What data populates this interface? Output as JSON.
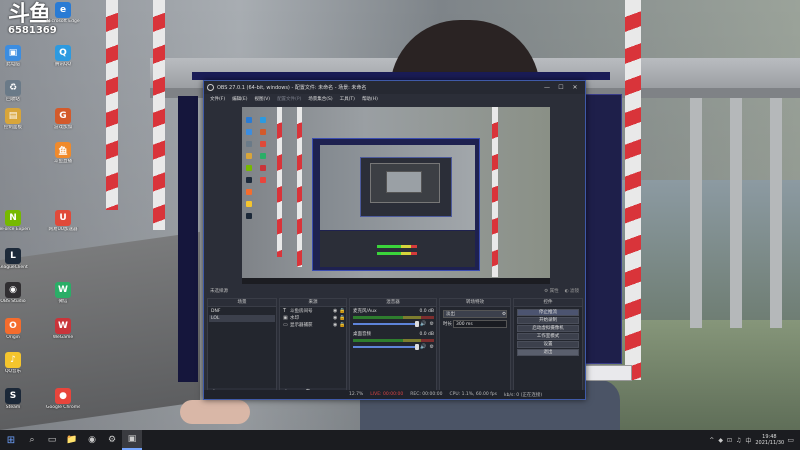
{
  "desktop": {
    "logo": {
      "glyph": "斗鱼",
      "room_number": "6581369"
    },
    "icons": [
      {
        "label": "Microsoft Edge",
        "color": "#2a7bd4",
        "glyph": "e"
      },
      {
        "label": "此电脑",
        "color": "#3c8de0",
        "glyph": "▣"
      },
      {
        "label": "腾讯QQ",
        "color": "#2d9ae0",
        "glyph": "Q"
      },
      {
        "label": "回收站",
        "color": "#6a7a88",
        "glyph": "♻"
      },
      {
        "label": "控制面板",
        "color": "#d8a53a",
        "glyph": "▤"
      },
      {
        "label": "游戏加加",
        "color": "#d35a2b",
        "glyph": "G"
      },
      {
        "label": "GeForce Experience",
        "color": "#76b900",
        "glyph": "N"
      },
      {
        "label": "网易UU加速器",
        "color": "#e04a3a",
        "glyph": "U"
      },
      {
        "label": "LeagueClient",
        "color": "#1d2a3a",
        "glyph": "L"
      },
      {
        "label": "OBS Studio",
        "color": "#302e31",
        "glyph": "◉"
      },
      {
        "label": "微信",
        "color": "#2aae67",
        "glyph": "W"
      },
      {
        "label": "Origin",
        "color": "#f56c2d",
        "glyph": "O"
      },
      {
        "label": "WeGame",
        "color": "#c9343a",
        "glyph": "W"
      },
      {
        "label": "QQ音乐",
        "color": "#f5c52d",
        "glyph": "♪"
      },
      {
        "label": "Steam",
        "color": "#1b2838",
        "glyph": "S"
      },
      {
        "label": "Google Chrome",
        "color": "#e8453c",
        "glyph": "●"
      },
      {
        "label": "斗鱼直播",
        "color": "#f08a2b",
        "glyph": "鱼"
      }
    ]
  },
  "obs": {
    "title": "OBS 27.0.1 (64-bit, windows) - 配置文件: 未命名 - 场景: 未命名",
    "window_controls": [
      "—",
      "☐",
      "✕"
    ],
    "menu": [
      "文件(F)",
      "编辑(E)",
      "视图(V)",
      "配置文件(P)",
      "场景集合(S)",
      "工具(T)",
      "帮助(H)"
    ],
    "no_source_label": "未选择源",
    "properties_label": "⚙ 属性",
    "filters_label": "◐ 滤镜",
    "scenes": {
      "title": "场景",
      "items": [
        "DNF",
        "LOL"
      ],
      "selected": 1
    },
    "sources": {
      "title": "来源",
      "items": [
        {
          "icon": "T",
          "label": "斗鱼房间号"
        },
        {
          "icon": "▣",
          "label": "水印"
        },
        {
          "icon": "▭",
          "label": "显示器捕获"
        }
      ]
    },
    "mixer": {
      "title": "混音器",
      "tracks": [
        {
          "name": "麦克风/Aux",
          "level": "0.0 dB"
        },
        {
          "name": "桌面音频",
          "level": "0.0 dB"
        }
      ]
    },
    "transitions": {
      "title": "转场特效",
      "type": "淡出",
      "duration_label": "时长",
      "duration": "300 ms"
    },
    "controls": {
      "title": "控件",
      "buttons": [
        "停止推流",
        "开始录制",
        "启动虚拟摄像机",
        "工作室模式",
        "设置",
        "退出"
      ]
    },
    "status": {
      "live": "LIVE: 00:00:00",
      "rec": "REC: 00:00:00",
      "cpu": "CPU: 1.1%, 60.00 fps",
      "kbps": "kb/s: 0 (正在连接)",
      "dropped": "12.7%"
    }
  },
  "taskbar": {
    "apps": [
      "⊞",
      "⌕",
      "▭",
      "📁",
      "◉",
      "⚙",
      "▣"
    ],
    "tray": [
      "^",
      "◆",
      "⊡",
      "♫",
      "中"
    ],
    "time": "19:48",
    "date": "2021/11/30"
  }
}
